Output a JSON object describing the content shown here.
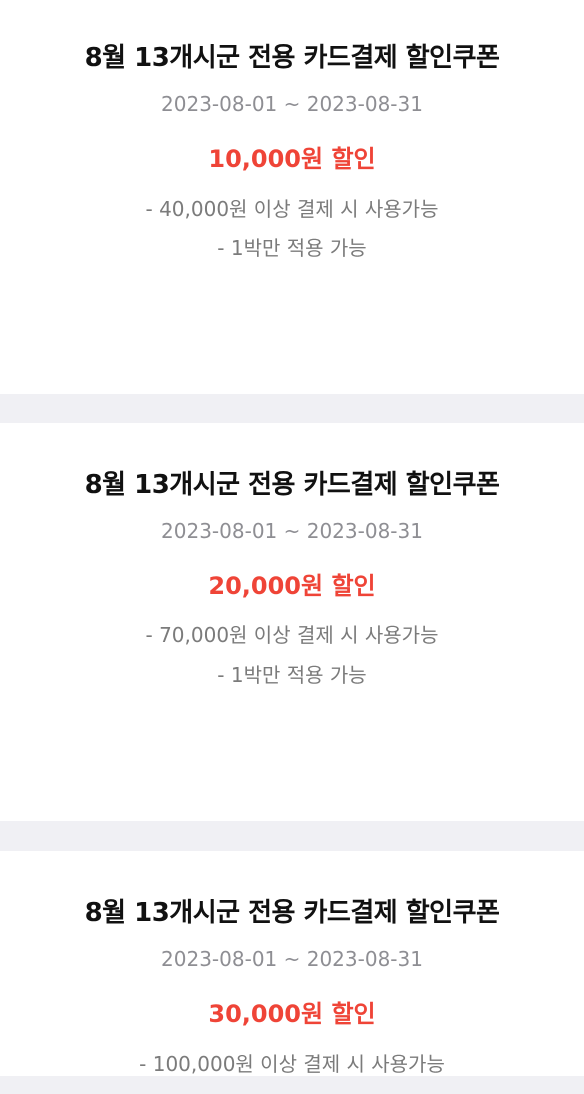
{
  "coupons": [
    {
      "title": "8월 13개시군 전용 카드결제 할인쿠폰",
      "period": "2023-08-01 ~ 2023-08-31",
      "discount": "10,000원 할인",
      "conditions": [
        "- 40,000원 이상 결제 시 사용가능",
        "- 1박만 적용 가능"
      ]
    },
    {
      "title": "8월 13개시군 전용 카드결제 할인쿠폰",
      "period": "2023-08-01 ~ 2023-08-31",
      "discount": "20,000원 할인",
      "conditions": [
        "- 70,000원 이상 결제 시 사용가능",
        "- 1박만 적용 가능"
      ]
    },
    {
      "title": "8월 13개시군 전용 카드결제 할인쿠폰",
      "period": "2023-08-01 ~ 2023-08-31",
      "discount": "30,000원 할인",
      "conditions": [
        "- 100,000원 이상 결제 시 사용가능"
      ]
    }
  ],
  "colors": {
    "discount": "#ef4437",
    "background": "#f0f0f4",
    "card": "#ffffff"
  }
}
